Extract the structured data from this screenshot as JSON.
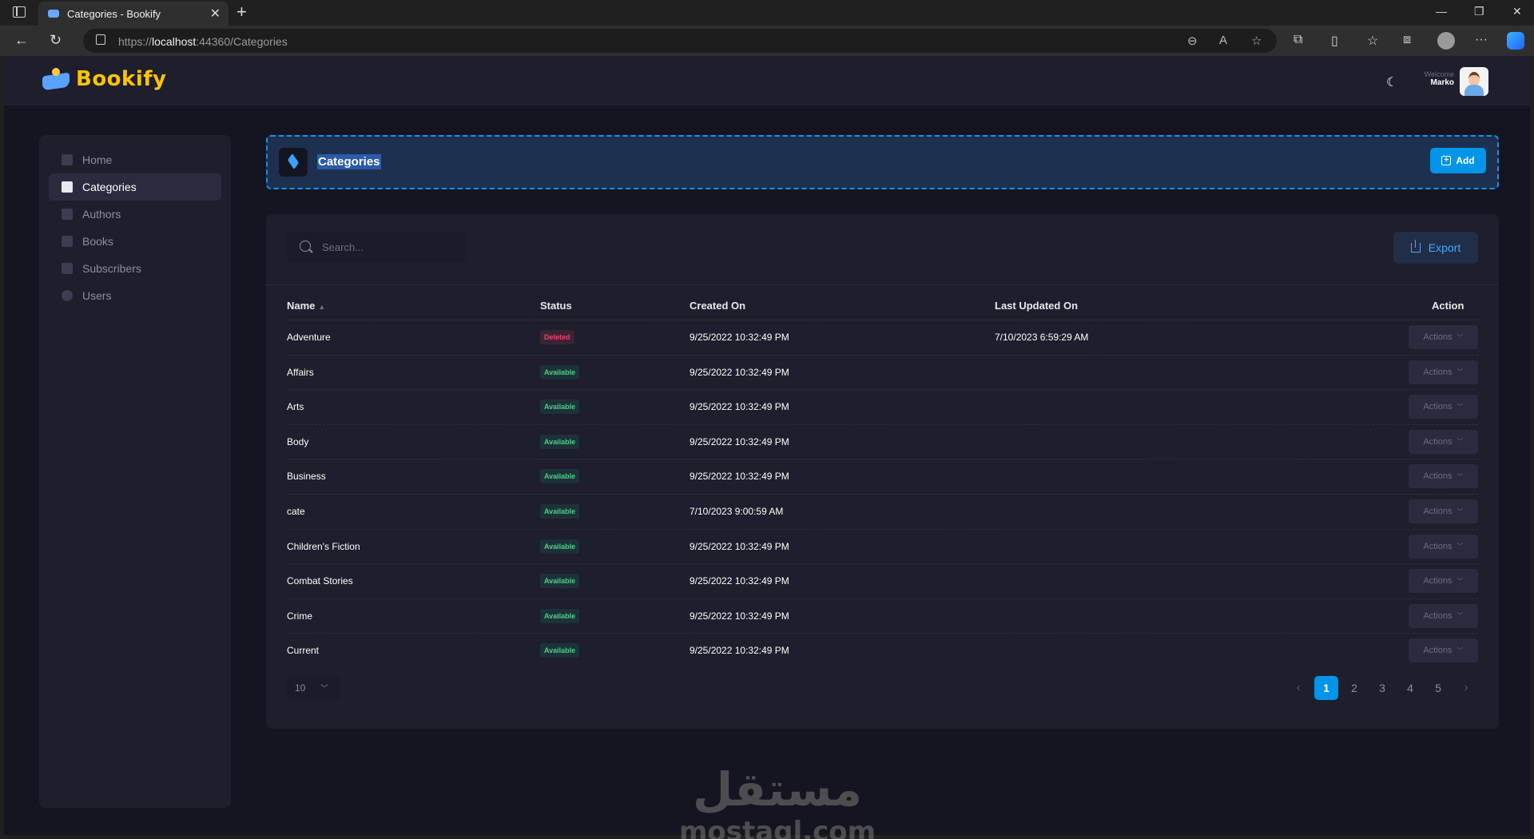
{
  "browser": {
    "tab_title": "Categories - Bookify",
    "url_prefix": "https://",
    "url_host": "localhost",
    "url_rest": ":44360/Categories"
  },
  "header": {
    "logo_text": "Bookify",
    "welcome_label": "Welcome",
    "user_name": "Marko"
  },
  "sidebar": {
    "items": [
      {
        "label": "Home",
        "icon": "home-icon",
        "active": false
      },
      {
        "label": "Categories",
        "icon": "layers-icon",
        "active": true
      },
      {
        "label": "Authors",
        "icon": "authors-icon",
        "active": false
      },
      {
        "label": "Books",
        "icon": "book-icon",
        "active": false
      },
      {
        "label": "Subscribers",
        "icon": "subscribers-icon",
        "active": false
      },
      {
        "label": "Users",
        "icon": "user-icon",
        "active": false
      }
    ]
  },
  "page": {
    "title": "Categories",
    "add_label": "Add",
    "search_placeholder": "Search...",
    "export_label": "Export"
  },
  "table": {
    "columns": [
      "Name",
      "Status",
      "Created On",
      "Last Updated On",
      "Action"
    ],
    "rows": [
      {
        "name": "Adventure",
        "status": "Deleted",
        "created": "9/25/2022 10:32:49 PM",
        "updated": "7/10/2023 6:59:29 AM",
        "action": "Actions"
      },
      {
        "name": "Affairs",
        "status": "Available",
        "created": "9/25/2022 10:32:49 PM",
        "updated": "",
        "action": "Actions"
      },
      {
        "name": "Arts",
        "status": "Available",
        "created": "9/25/2022 10:32:49 PM",
        "updated": "",
        "action": "Actions"
      },
      {
        "name": "Body",
        "status": "Available",
        "created": "9/25/2022 10:32:49 PM",
        "updated": "",
        "action": "Actions"
      },
      {
        "name": "Business",
        "status": "Available",
        "created": "9/25/2022 10:32:49 PM",
        "updated": "",
        "action": "Actions"
      },
      {
        "name": "cate",
        "status": "Available",
        "created": "7/10/2023 9:00:59 AM",
        "updated": "",
        "action": "Actions"
      },
      {
        "name": "Children's Fiction",
        "status": "Available",
        "created": "9/25/2022 10:32:49 PM",
        "updated": "",
        "action": "Actions"
      },
      {
        "name": "Combat Stories",
        "status": "Available",
        "created": "9/25/2022 10:32:49 PM",
        "updated": "",
        "action": "Actions"
      },
      {
        "name": "Crime",
        "status": "Available",
        "created": "9/25/2022 10:32:49 PM",
        "updated": "",
        "action": "Actions"
      },
      {
        "name": "Current",
        "status": "Available",
        "created": "9/25/2022 10:32:49 PM",
        "updated": "",
        "action": "Actions"
      }
    ]
  },
  "pagination": {
    "page_size": "10",
    "pages": [
      "1",
      "2",
      "3",
      "4",
      "5"
    ],
    "current": "1"
  },
  "watermark": {
    "arabic": "مستقل",
    "latin": "mostaql.com"
  },
  "colors": {
    "accent": "#0095e8",
    "available": "#50cd89",
    "deleted": "#f1416c",
    "logo": "#ffc400"
  }
}
